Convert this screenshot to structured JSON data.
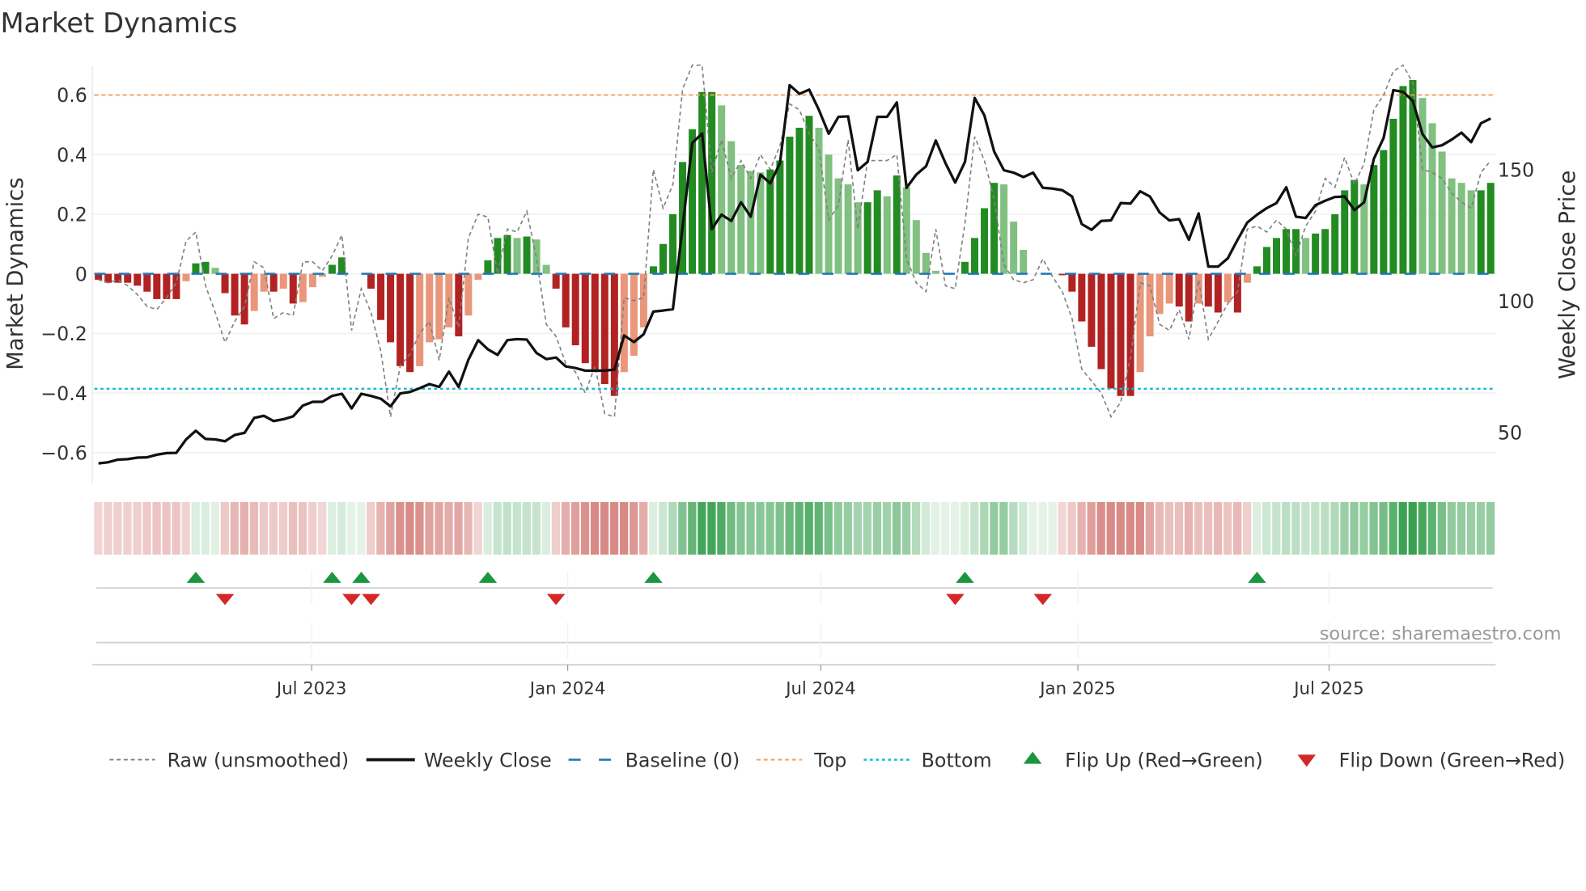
{
  "chart_data": {
    "type": "bar",
    "title": "Market Dynamics",
    "ylabel": "Market Dynamics",
    "y2label": "Weekly Close Price",
    "ylim": [
      -0.7,
      0.7
    ],
    "y2ticks": [
      150,
      100,
      50
    ],
    "yticks": [
      0.6,
      0.4,
      0.2,
      0,
      -0.2,
      -0.4,
      -0.6
    ],
    "ytick_labels": [
      "0.6",
      "0.4",
      "0.2",
      "0",
      "−0.2",
      "−0.4",
      "−0.6"
    ],
    "x_start": "2023-01-29",
    "x_step_days": 7,
    "xticks": [
      {
        "label": "Jul 2023",
        "week": 21.9
      },
      {
        "label": "Jan 2024",
        "week": 48.2
      },
      {
        "label": "Jul 2024",
        "week": 74.2
      },
      {
        "label": "Jan 2025",
        "week": 100.6
      },
      {
        "label": "Jul 2025",
        "week": 126.4
      }
    ],
    "top_level": 0.6,
    "bottom_level": -0.386,
    "baseline": 0,
    "source": "source: sharemaestro.com",
    "series": [
      {
        "name": "Market Dynamics (smoothed)",
        "values": [
          -0.02,
          -0.03,
          -0.03,
          -0.03,
          -0.04,
          -0.06,
          -0.085,
          -0.085,
          -0.085,
          -0.025,
          0.035,
          0.04,
          0.02,
          -0.065,
          -0.14,
          -0.17,
          -0.125,
          -0.06,
          -0.06,
          -0.05,
          -0.1,
          -0.095,
          -0.045,
          -0.01,
          0.03,
          0.055,
          0,
          0,
          -0.05,
          -0.155,
          -0.23,
          -0.31,
          -0.33,
          -0.31,
          -0.23,
          -0.22,
          -0.18,
          -0.21,
          -0.14,
          -0.02,
          0.045,
          0.12,
          0.13,
          0.12,
          0.125,
          0.115,
          0.03,
          -0.05,
          -0.18,
          -0.24,
          -0.3,
          -0.33,
          -0.37,
          -0.41,
          -0.33,
          -0.275,
          -0.18,
          0.025,
          0.1,
          0.2,
          0.375,
          0.485,
          0.61,
          0.61,
          0.565,
          0.445,
          0.365,
          0.345,
          0.34,
          0.35,
          0.38,
          0.46,
          0.49,
          0.53,
          0.49,
          0.4,
          0.32,
          0.3,
          0.24,
          0.24,
          0.28,
          0.26,
          0.33,
          0.29,
          0.18,
          0.07,
          0.01,
          0,
          0,
          0.04,
          0.12,
          0.22,
          0.305,
          0.3,
          0.175,
          0.08,
          0,
          0,
          0,
          -0.005,
          -0.06,
          -0.16,
          -0.245,
          -0.32,
          -0.385,
          -0.41,
          -0.41,
          -0.33,
          -0.21,
          -0.135,
          -0.1,
          -0.11,
          -0.16,
          -0.1,
          -0.11,
          -0.13,
          -0.095,
          -0.13,
          -0.03,
          0.025,
          0.09,
          0.12,
          0.15,
          0.15,
          0.12,
          0.135,
          0.15,
          0.2,
          0.28,
          0.315,
          0.3,
          0.365,
          0.415,
          0.52,
          0.63,
          0.65,
          0.59,
          0.505,
          0.41,
          0.32,
          0.305,
          0.28,
          0.28,
          0.305
        ]
      },
      {
        "name": "Raw (unsmoothed)",
        "values": [
          -0.02,
          -0.03,
          -0.02,
          -0.04,
          -0.07,
          -0.11,
          -0.12,
          -0.08,
          -0.03,
          0.11,
          0.14,
          -0.04,
          -0.13,
          -0.23,
          -0.16,
          -0.11,
          0.04,
          0.02,
          -0.15,
          -0.13,
          -0.14,
          0.04,
          0.04,
          0.01,
          0.06,
          0.13,
          -0.19,
          -0.05,
          -0.13,
          -0.26,
          -0.48,
          -0.31,
          -0.27,
          -0.2,
          -0.16,
          -0.29,
          -0.08,
          -0.18,
          0.12,
          0.2,
          0.19,
          0,
          0.15,
          0.14,
          0.21,
          0.05,
          -0.17,
          -0.21,
          -0.3,
          -0.33,
          -0.4,
          -0.31,
          -0.47,
          -0.48,
          -0.08,
          -0.09,
          -0.08,
          0.35,
          0.22,
          0.3,
          0.62,
          0.7,
          0.7,
          0.34,
          0.45,
          0.32,
          0.38,
          0.32,
          0.4,
          0.35,
          0.43,
          0.57,
          0.55,
          0.47,
          0.42,
          0.18,
          0.23,
          0.45,
          0.15,
          0.38,
          0.38,
          0.38,
          0.4,
          0.05,
          -0.03,
          -0.06,
          0.15,
          -0.04,
          -0.05,
          0.17,
          0.46,
          0.38,
          0.25,
          0.03,
          -0.02,
          -0.03,
          -0.02,
          0.05,
          -0.01,
          -0.06,
          -0.15,
          -0.32,
          -0.36,
          -0.4,
          -0.48,
          -0.43,
          -0.28,
          -0.03,
          -0.04,
          -0.17,
          -0.19,
          -0.12,
          -0.22,
          -0.02,
          -0.22,
          -0.16,
          -0.1,
          -0.06,
          0.15,
          0.16,
          0.14,
          0.18,
          0.15,
          0.06,
          0.16,
          0.21,
          0.32,
          0.29,
          0.39,
          0.3,
          0.37,
          0.55,
          0.6,
          0.68,
          0.7,
          0.64,
          0.35,
          0.34,
          0.32,
          0.27,
          0.24,
          0.22,
          0.34,
          0.38
        ]
      },
      {
        "name": "Weekly Close",
        "values": [
          38.2,
          38.6,
          39.6,
          39.8,
          40.4,
          40.5,
          41.5,
          42.1,
          42.2,
          47.3,
          50.6,
          47.5,
          47.3,
          46.6,
          49.0,
          49.8,
          55.5,
          56.3,
          54.3,
          55.0,
          56.1,
          60.2,
          61.6,
          61.6,
          63.9,
          64.7,
          59.1,
          64.7,
          63.9,
          62.8,
          59.9,
          64.8,
          65.4,
          66.8,
          68.4,
          67.3,
          73.1,
          67.3,
          77.6,
          85.1,
          81.6,
          79.5,
          85.1,
          85.5,
          85.3,
          80.2,
          77.9,
          78.5,
          75.1,
          74.5,
          73.5,
          73.5,
          73.5,
          73.9,
          86.9,
          84.4,
          87.4,
          96.0,
          96.4,
          96.9,
          128.2,
          160.2,
          163.8,
          127.4,
          132.9,
          130.5,
          137.6,
          132.1,
          148.1,
          144.8,
          152.5,
          182.2,
          178.9,
          180.5,
          172.8,
          163.7,
          170.1,
          170.3,
          149.8,
          153.0,
          170.1,
          170.1,
          175.6,
          143.1,
          148.1,
          151.3,
          161.1,
          152.5,
          145.1,
          153.0,
          177.3,
          170.7,
          156.9,
          149.8,
          148.9,
          147.2,
          148.9,
          143.1,
          142.8,
          142.2,
          139.8,
          129.3,
          127.1,
          130.5,
          130.7,
          137.3,
          137.1,
          141.8,
          139.8,
          133.7,
          130.7,
          131.2,
          123.3,
          133.4,
          113.1,
          113.1,
          116.3,
          123.3,
          129.9,
          132.9,
          135.4,
          137.3,
          143.3,
          132.1,
          131.6,
          136.5,
          138.2,
          139.6,
          139.8,
          134.6,
          137.6,
          154.1,
          162.1,
          180.3,
          179.6,
          176.2,
          163.5,
          158.5,
          159.3,
          161.5,
          164.1,
          160.5,
          167.7,
          169.5
        ]
      }
    ],
    "flip_up_weeks": [
      10,
      24,
      27,
      40,
      57,
      89,
      119
    ],
    "flip_down_weeks": [
      13,
      26,
      28,
      47,
      88,
      97
    ],
    "legend": {
      "placement": "bottom",
      "items": [
        "Raw (unsmoothed)",
        "Weekly Close",
        "Baseline (0)",
        "Top",
        "Bottom",
        "Flip Up (Red→Green)",
        "Flip Down (Green→Red)"
      ]
    },
    "colors": {
      "strong_green": "#228b22",
      "light_green": "#80c080",
      "strong_red": "#b22222",
      "light_red": "#e9967a",
      "top": "#f4a460",
      "bottom": "#17becf",
      "baseline": "#1f77b4",
      "close": "#111111",
      "raw": "#808080",
      "flip_up": "#1a9641",
      "flip_down": "#d62728"
    }
  }
}
